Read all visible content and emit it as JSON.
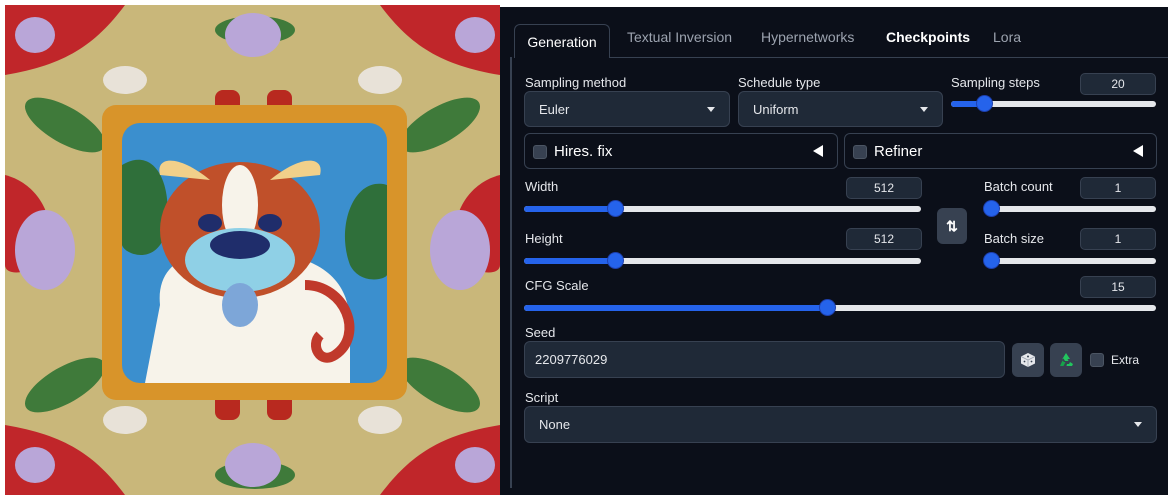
{
  "tabs": [
    {
      "label": "Generation"
    },
    {
      "label": "Textual Inversion"
    },
    {
      "label": "Hypernetworks"
    },
    {
      "label": "Checkpoints"
    },
    {
      "label": "Lora"
    }
  ],
  "sampling_method": {
    "label": "Sampling method",
    "value": "Euler"
  },
  "schedule_type": {
    "label": "Schedule type",
    "value": "Uniform"
  },
  "sampling_steps": {
    "label": "Sampling steps",
    "value": "20",
    "fraction": 0.16
  },
  "hires_fix": {
    "label": "Hires. fix",
    "checked": false
  },
  "refiner": {
    "label": "Refiner",
    "checked": false
  },
  "width": {
    "label": "Width",
    "value": "512",
    "fraction": 0.23
  },
  "height": {
    "label": "Height",
    "value": "512",
    "fraction": 0.23
  },
  "batch_count": {
    "label": "Batch count",
    "value": "1",
    "fraction": 0.0
  },
  "batch_size": {
    "label": "Batch size",
    "value": "1",
    "fraction": 0.0
  },
  "cfg_scale": {
    "label": "CFG Scale",
    "value": "15",
    "fraction": 0.48
  },
  "seed": {
    "label": "Seed",
    "value": "2209776029"
  },
  "extra": {
    "label": "Extra",
    "checked": false
  },
  "script": {
    "label": "Script",
    "value": "None"
  },
  "swap_glyph": "⇅",
  "colors": {
    "accent": "#2563eb",
    "panel_bg": "#0b0f19",
    "input_bg": "#1f2937",
    "recycle_green": "#22c55e"
  },
  "icons": [
    "dice-icon",
    "recycle-icon",
    "swap-icon",
    "caret-down-icon",
    "collapse-triangle-icon"
  ]
}
